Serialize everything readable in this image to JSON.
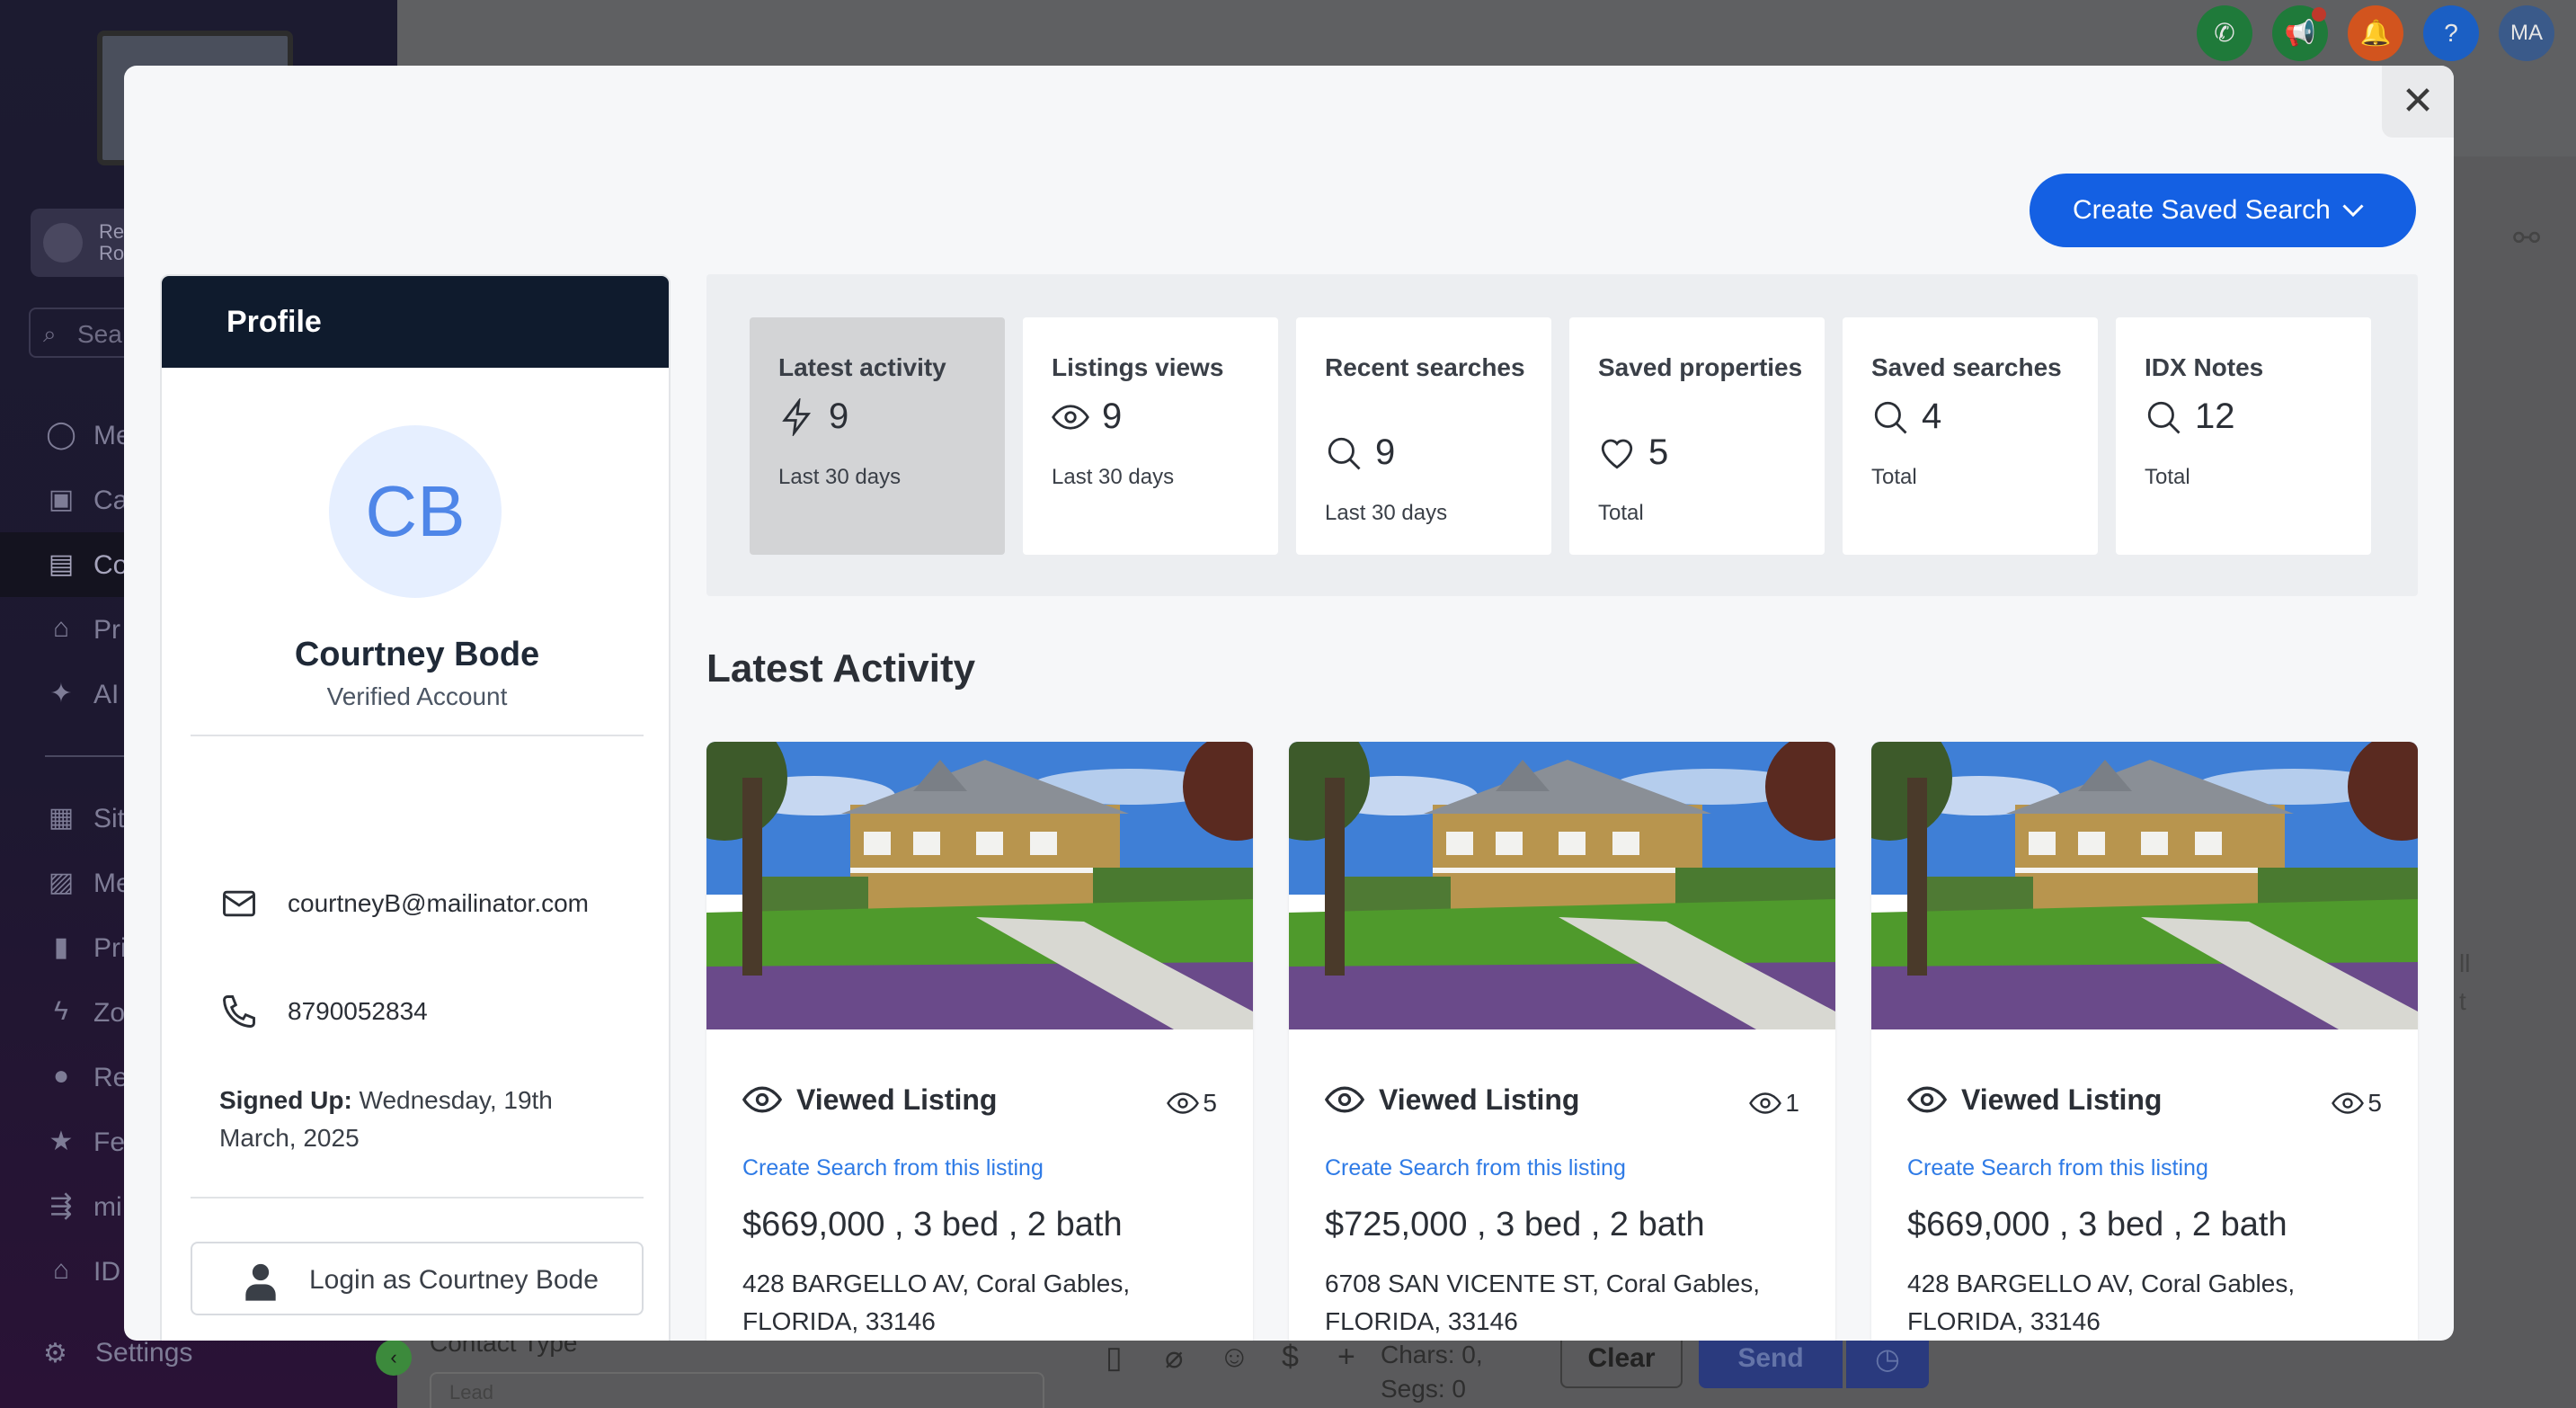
{
  "background": {
    "account_lines": [
      "Re",
      "Ro"
    ],
    "search_placeholder": "Sea",
    "nav_items": [
      {
        "label": "Me",
        "icon": "chat-icon"
      },
      {
        "label": "Ca",
        "icon": "calendar-icon"
      },
      {
        "label": "Co",
        "icon": "contacts-icon"
      },
      {
        "label": "Pr",
        "icon": "home-icon"
      },
      {
        "label": "AI",
        "icon": "sparkle-icon"
      },
      {
        "label": "Sit",
        "icon": "site-icon"
      },
      {
        "label": "Me",
        "icon": "media-icon"
      },
      {
        "label": "Pri",
        "icon": "building-icon"
      },
      {
        "label": "Zo",
        "icon": "zap-icon"
      },
      {
        "label": "Re",
        "icon": "users-icon"
      },
      {
        "label": "Fe",
        "icon": "star-icon"
      },
      {
        "label": "mi",
        "icon": "route-icon"
      },
      {
        "label": "ID",
        "icon": "home-icon"
      }
    ],
    "settings_label": "Settings",
    "top_avatar_initials": "MA",
    "contact_type_label": "Contact Type",
    "contact_type_value": "Lead",
    "chars_label": "Chars: 0,",
    "segs_label": "Segs: 0",
    "clear_label": "Clear",
    "send_label": "Send",
    "right_fragments": [
      "ll",
      "t"
    ]
  },
  "modal": {
    "close_glyph": "✕",
    "create_saved_search_label": "Create Saved Search",
    "profile": {
      "header": "Profile",
      "initials": "CB",
      "name": "Courtney Bode",
      "status": "Verified Account",
      "email": "courtneyB@mailinator.com",
      "phone": "8790052834",
      "signed_up_label": "Signed Up:",
      "signed_up_value": "Wednesday, 19th March, 2025",
      "login_label": "Login as Courtney Bode"
    },
    "stats": [
      {
        "title": "Latest activity",
        "value": "9",
        "sub": "Last 30 days",
        "icon": "bolt-icon"
      },
      {
        "title": "Listings views",
        "value": "9",
        "sub": "Last 30 days",
        "icon": "eye-icon"
      },
      {
        "title": "Recent searches",
        "value": "9",
        "sub": "Last 30 days",
        "icon": "search-icon"
      },
      {
        "title": "Saved properties",
        "value": "5",
        "sub": "Total",
        "icon": "heart-icon"
      },
      {
        "title": "Saved searches",
        "value": "4",
        "sub": "Total",
        "icon": "search-icon"
      },
      {
        "title": "IDX Notes",
        "value": "12",
        "sub": "Total",
        "icon": "search-icon"
      }
    ],
    "section_title": "Latest Activity",
    "listings": [
      {
        "title": "Viewed Listing",
        "views": "5",
        "link": "Create Search from this listing",
        "price": "$669,000 , 3 bed , 2 bath",
        "address": "428 BARGELLO AV, Coral Gables, FLORIDA, 33146"
      },
      {
        "title": "Viewed Listing",
        "views": "1",
        "link": "Create Search from this listing",
        "price": "$725,000 , 3 bed , 2 bath",
        "address": "6708 SAN VICENTE ST, Coral Gables, FLORIDA, 33146"
      },
      {
        "title": "Viewed Listing",
        "views": "5",
        "link": "Create Search from this listing",
        "price": "$669,000 , 3 bed , 2 bath",
        "address": "428 BARGELLO AV, Coral Gables, FLORIDA, 33146"
      }
    ]
  },
  "colors": {
    "primary_blue": "#1460e3",
    "link_blue": "#2f7be6",
    "profile_header": "#0f1b2d",
    "avatar_bg": "#e6efff",
    "avatar_text": "#4f86e8"
  }
}
